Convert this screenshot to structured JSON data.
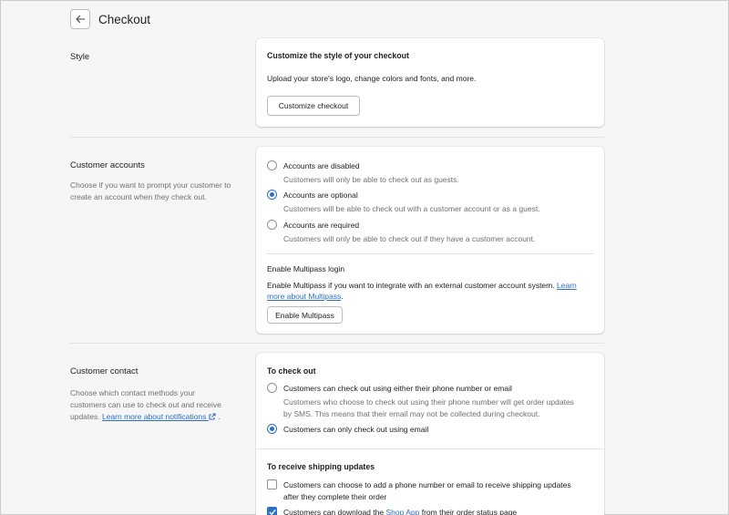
{
  "header": {
    "title": "Checkout"
  },
  "style_section": {
    "title": "Style",
    "card_heading": "Customize the style of your checkout",
    "card_text": "Upload your store's logo, change colors and fonts, and more.",
    "button_label": "Customize checkout"
  },
  "accounts_section": {
    "title": "Customer accounts",
    "description": "Choose if you want to prompt your customer to create an account when they check out.",
    "options": [
      {
        "label": "Accounts are disabled",
        "help": "Customers will only be able to check out as guests.",
        "selected": false
      },
      {
        "label": "Accounts are optional",
        "help": "Customers will be able to check out with a customer account or as a guest.",
        "selected": true
      },
      {
        "label": "Accounts are required",
        "help": "Customers will only be able to check out if they have a customer account.",
        "selected": false
      }
    ],
    "multipass": {
      "heading": "Enable Multipass login",
      "text_line1": "Enable Multipass if you want to integrate with an external customer account system.",
      "link_part1": "Learn",
      "link_part2": "more about Multipass",
      "text_end": ".",
      "button_label": "Enable Multipass"
    }
  },
  "contact_section": {
    "title": "Customer contact",
    "description": "Choose which contact methods your customers can use to check out and receive updates.",
    "link_text": "Learn more about notifications",
    "link_end": ".",
    "checkout_heading": "To check out",
    "checkout_options": [
      {
        "label": "Customers can check out using either their phone number or email",
        "help_line1": "Customers who choose to check out using their phone number will get order updates",
        "help_line2": "by SMS. This means that their email may not be collected during checkout.",
        "selected": false
      },
      {
        "label": "Customers can only check out using email",
        "selected": true
      }
    ],
    "shipping_heading": "To receive shipping updates",
    "shipping_options": [
      {
        "label_line1": "Customers can choose to add a phone number or email to receive shipping updates",
        "label_line2": "after they complete their order",
        "checked": false
      },
      {
        "label_before": "Customers can download the",
        "link": "Shop App",
        "label_after": "from their order status page",
        "checked": true
      }
    ]
  },
  "colors": {
    "accent": "#2c6ecb",
    "background": "#f6f6f7",
    "muted_text": "#6d7175"
  },
  "icons": {
    "back": "arrow-left-icon",
    "external": "external-link-icon",
    "check": "checkmark-icon"
  }
}
